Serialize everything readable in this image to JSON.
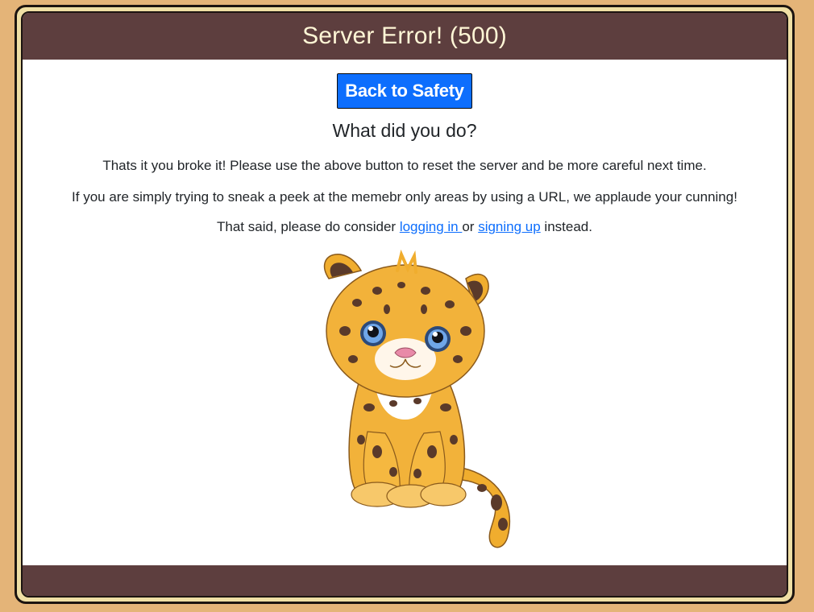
{
  "header": {
    "title": "Server Error! (500)"
  },
  "main": {
    "button_label": "Back to Safety",
    "heading": "What did you do?",
    "paragraph1": "Thats it you broke it! Please use the above button to reset the server and be more careful next time.",
    "paragraph2": "If you are simply trying to sneak a peek at the memebr only areas by using a URL, we applaude your cunning!",
    "paragraph3": {
      "prefix": "That said, please do consider ",
      "login_link": "logging in ",
      "middle": "or ",
      "signup_link": "signing up",
      "suffix": " instead."
    },
    "illustration": "jaguar-cub-illustration"
  },
  "colors": {
    "page_background": "#e4b478",
    "header_background": "#5d3e3e",
    "header_text": "#fff6d6",
    "button_background": "#0d6efd",
    "link": "#0d6efd"
  }
}
